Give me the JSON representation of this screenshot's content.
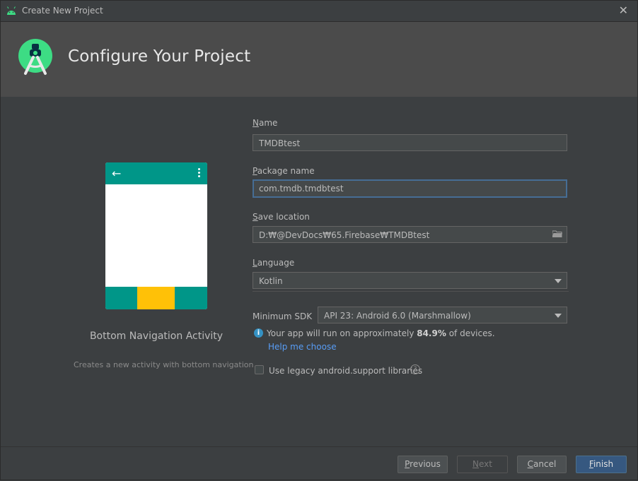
{
  "window": {
    "title": "Create New Project",
    "close_glyph": "✕"
  },
  "header": {
    "title": "Configure Your Project"
  },
  "template": {
    "name": "Bottom Navigation Activity",
    "description": "Creates a new activity with bottom navigation",
    "phone_back_glyph": "←"
  },
  "form": {
    "name": {
      "label_key": "N",
      "label_rest": "ame",
      "value": "TMDBtest"
    },
    "package": {
      "label_key": "P",
      "label_rest": "ackage name",
      "value": "com.tmdb.tmdbtest"
    },
    "save_location": {
      "label_key": "S",
      "label_rest": "ave location",
      "value": "D:₩@DevDocs₩65.Firebase₩TMDBtest"
    },
    "language": {
      "label_key": "L",
      "label_rest": "anguage",
      "value": "Kotlin"
    },
    "min_sdk": {
      "label": "Minimum SDK",
      "value": "API 23: Android 6.0 (Marshmallow)"
    },
    "info": {
      "prefix": "Your app will run on approximately ",
      "percent": "84.9%",
      "suffix": " of devices.",
      "icon_glyph": "i"
    },
    "help_link": "Help me choose",
    "legacy_checkbox": {
      "label": "Use legacy android.support libraries",
      "checked": false,
      "help_glyph": "?"
    }
  },
  "buttons": {
    "previous": {
      "key": "P",
      "rest": "revious"
    },
    "next": {
      "key": "N",
      "rest": "ext"
    },
    "cancel": {
      "key": "C",
      "rest": "ancel"
    },
    "finish": {
      "key": "F",
      "rest": "inish"
    }
  },
  "colors": {
    "accent": "#009688",
    "nav_highlight": "#ffc107",
    "link": "#589df6",
    "primary_button": "#365880"
  },
  "icons": [
    "android-icon",
    "close-icon",
    "android-studio-logo",
    "back-arrow-icon",
    "overflow-menu-icon",
    "folder-icon",
    "dropdown-arrow-icon",
    "info-icon",
    "help-icon"
  ]
}
